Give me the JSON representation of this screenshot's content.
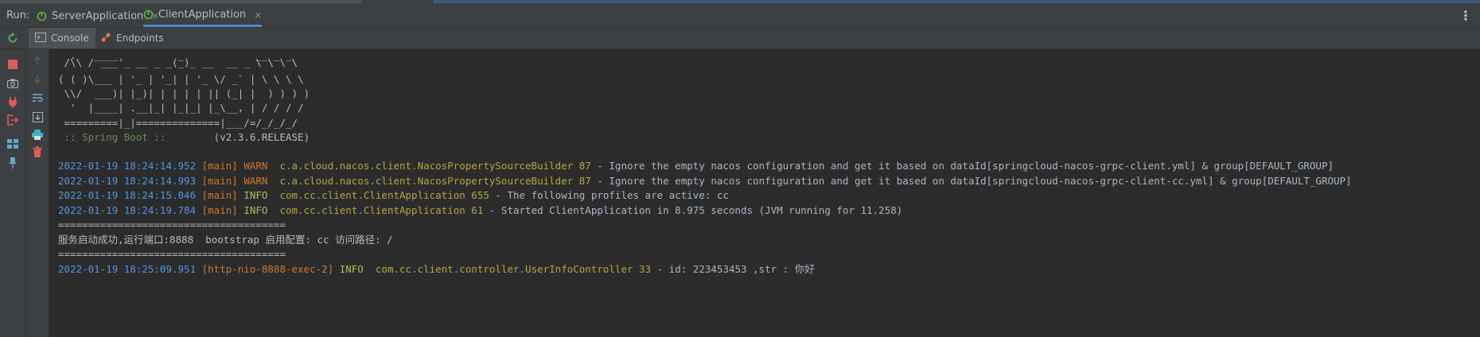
{
  "run_bar": {
    "label": "Run:",
    "tabs": [
      {
        "label": "ServerApplication",
        "active": false
      },
      {
        "label": "ClientApplication",
        "active": true
      }
    ],
    "close_glyph": "×",
    "menu_glyph": "⋮"
  },
  "sub_tabs": [
    {
      "label": "Console",
      "icon": "console-icon",
      "active": true
    },
    {
      "label": "Endpoints",
      "icon": "endpoints-icon",
      "active": false
    }
  ],
  "console": {
    "banner": [
      "  .   ____          _            __ _ _",
      " /\\\\ / ___'_ __ _ _(_)_ __  __ _ \\ \\ \\ \\",
      "( ( )\\___ | '_ | '_| | '_ \\/ _` | \\ \\ \\ \\",
      " \\\\/  ___)| |_)| | | | | || (_| |  ) ) ) )",
      "  '  |____| .__|_| |_|_| |_\\__, | / / / /",
      " =========|_|==============|___/=/_/_/_/"
    ],
    "spring_label": " :: Spring Boot :: ",
    "spring_version": "       (v2.3.6.RELEASE)",
    "logs": [
      {
        "ts": "2022-01-19 18:24:14.952",
        "thread": "[main]",
        "level": "WARN ",
        "logger": "c.a.cloud.nacos.client.NacosPropertySourceBuilder 87",
        "msg": " - Ignore the empty nacos configuration and get it based on dataId[springcloud-nacos-grpc-client.yml] & group[DEFAULT_GROUP]"
      },
      {
        "ts": "2022-01-19 18:24:14.993",
        "thread": "[main]",
        "level": "WARN ",
        "logger": "c.a.cloud.nacos.client.NacosPropertySourceBuilder 87",
        "msg": " - Ignore the empty nacos configuration and get it based on dataId[springcloud-nacos-grpc-client-cc.yml] & group[DEFAULT_GROUP]"
      },
      {
        "ts": "2022-01-19 18:24:15.046",
        "thread": "[main]",
        "level": "INFO ",
        "logger": "com.cc.client.ClientApplication 655",
        "msg": " - The following profiles are active: cc"
      },
      {
        "ts": "2022-01-19 18:24:19.784",
        "thread": "[main]",
        "level": "INFO ",
        "logger": "com.cc.client.ClientApplication 61",
        "msg": " - Started ClientApplication in 8.975 seconds (JVM running for 11.258)"
      }
    ],
    "separator1": "======================================",
    "startup_msg": "服务启动成功,运行端口:8888  bootstrap 启用配置: cc 访问路径: /",
    "separator2": "======================================",
    "last_log": {
      "ts": "2022-01-19 18:25:09.951",
      "thread": "[http-nio-8888-exec-2]",
      "level": "INFO ",
      "logger": "com.cc.client.controller.UserInfoController 33",
      "msg": " - id: 223453453 ,str : 你好"
    }
  },
  "toolbar_icons": [
    "rerun-icon",
    "stop-icon",
    "camera-icon",
    "plug-icon",
    "exit-icon",
    "layout-icon",
    "pin-icon",
    "up-arrow-icon",
    "down-arrow-icon",
    "soft-wrap-icon",
    "scroll-to-end-icon",
    "print-icon",
    "trash-icon"
  ]
}
